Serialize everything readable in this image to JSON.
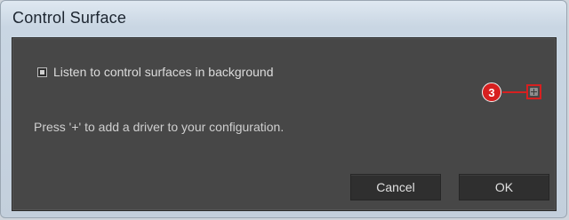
{
  "window": {
    "title": "Control Surface"
  },
  "options": {
    "listen_in_background": {
      "label": "Listen to control surfaces in background",
      "checked": true
    }
  },
  "callout": {
    "number": "3",
    "color": "#d72020"
  },
  "hint_text": "Press '+' to add a driver to your configuration.",
  "buttons": {
    "cancel_label": "Cancel",
    "ok_label": "OK"
  }
}
